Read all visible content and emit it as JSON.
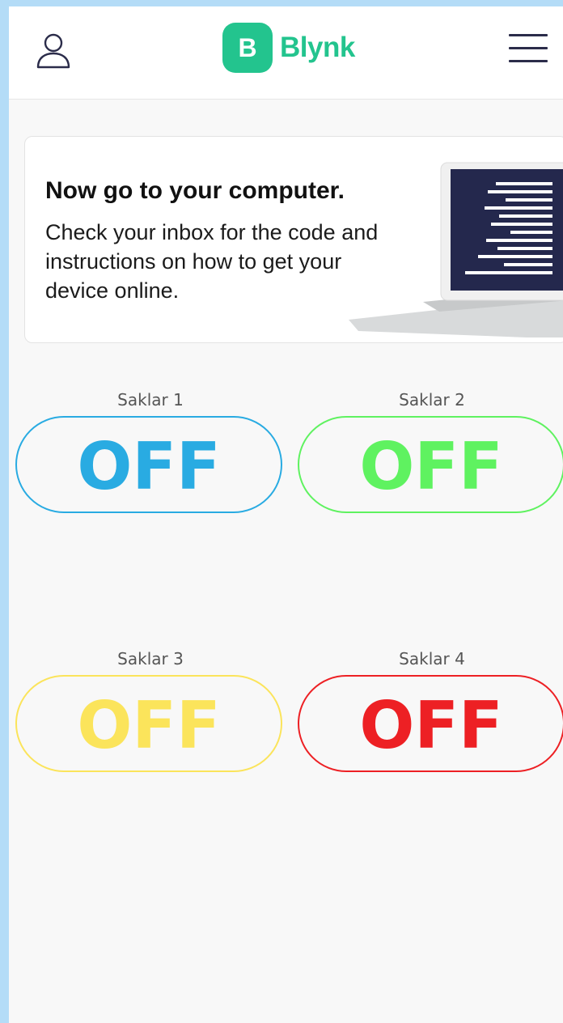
{
  "header": {
    "logo_letter": "B",
    "logo_text": "Blynk",
    "brand_color": "#23c48e",
    "user_icon": "user-icon",
    "menu_icon": "hamburger-menu-icon"
  },
  "banner": {
    "title": "Now go to your computer.",
    "body": "Check your inbox for the code and instructions on how to get your device online.",
    "image_icon": "laptop-illustration"
  },
  "switches": [
    {
      "label": "Saklar 1",
      "state": "OFF",
      "color": "#29abe2"
    },
    {
      "label": "Saklar 2",
      "state": "OFF",
      "color": "#5ff260"
    },
    {
      "label": "Saklar 3",
      "state": "OFF",
      "color": "#fbe45b"
    },
    {
      "label": "Saklar 4",
      "state": "OFF",
      "color": "#ed2024"
    }
  ]
}
